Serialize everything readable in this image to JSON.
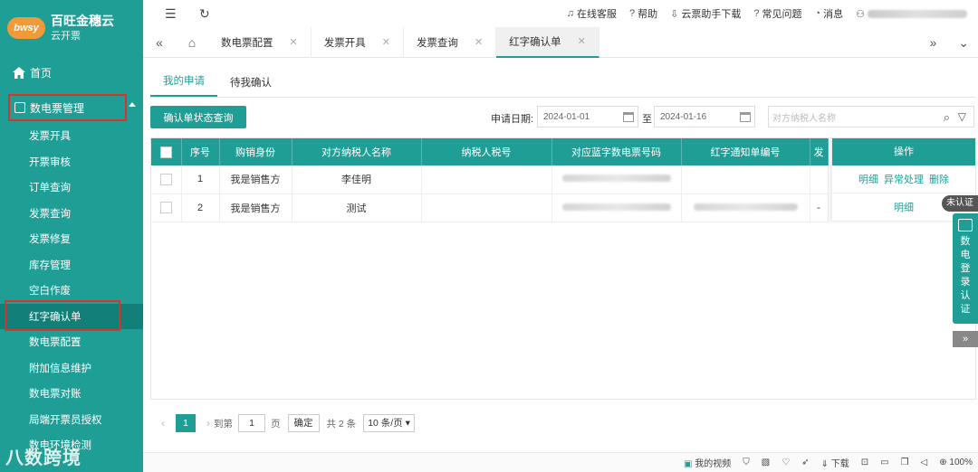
{
  "brand": {
    "logo_badge": "bwsy",
    "title": "百旺金穗云",
    "subtitle": "云开票"
  },
  "sidebar": {
    "home": "首页",
    "group": "数电票管理",
    "items": [
      {
        "label": "发票开具"
      },
      {
        "label": "开票审核"
      },
      {
        "label": "订单查询"
      },
      {
        "label": "发票查询"
      },
      {
        "label": "发票修复"
      },
      {
        "label": "库存管理"
      },
      {
        "label": "空白作废"
      },
      {
        "label": "红字确认单"
      },
      {
        "label": "数电票配置"
      },
      {
        "label": "附加信息维护"
      },
      {
        "label": "数电票对账"
      },
      {
        "label": "局端开票员授权"
      },
      {
        "label": "数电环境检测"
      }
    ]
  },
  "topbar": {
    "items": [
      "在线客服",
      "帮助",
      "云票助手下载",
      "常见问题",
      "消息"
    ]
  },
  "tabs": [
    {
      "label": "数电票配置"
    },
    {
      "label": "发票开具"
    },
    {
      "label": "发票查询"
    },
    {
      "label": "红字确认单"
    }
  ],
  "subtabs": [
    "我的申请",
    "待我确认"
  ],
  "toolbar": {
    "query_button": "确认单状态查询",
    "date_label": "申请日期:",
    "date_start": "2024-01-01",
    "date_sep": "至",
    "date_end": "2024-01-16",
    "search_placeholder": "对方纳税人名称"
  },
  "table": {
    "headers": [
      "序号",
      "购销身份",
      "对方纳税人名称",
      "纳税人税号",
      "对应蓝字数电票号码",
      "红字通知单编号",
      "发"
    ],
    "op_header": "操作",
    "rows": [
      {
        "no": "1",
        "role": "我是销售方",
        "name": "李佳明",
        "ops": [
          "明细",
          "异常处理",
          "删除"
        ]
      },
      {
        "no": "2",
        "role": "我是销售方",
        "name": "测试",
        "extra": "-",
        "ops": [
          "明细"
        ]
      }
    ]
  },
  "pager": {
    "page": "1",
    "goto_prefix": "到第",
    "goto_value": "1",
    "goto_suffix": "页",
    "confirm": "确定",
    "total": "共 2 条",
    "page_size": "10 条/页"
  },
  "statusbar": {
    "video": "我的视频",
    "download": "下载",
    "zoom": "100%"
  },
  "float": {
    "badge": "未认证",
    "panel_text": [
      "数",
      "电",
      "登",
      "录",
      "认",
      "证"
    ],
    "expand": "»"
  },
  "watermark": "八数跨境"
}
